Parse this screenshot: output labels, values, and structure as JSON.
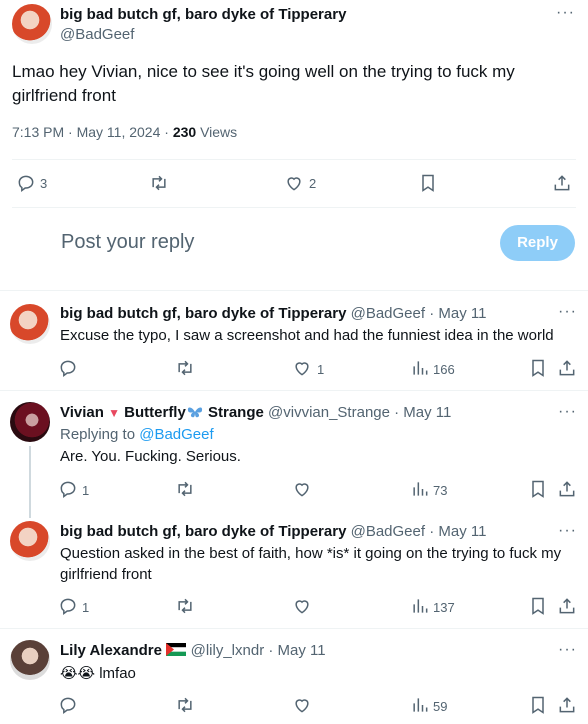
{
  "main": {
    "author_name": "big bad butch gf, baro dyke of Tipperary",
    "author_handle": "@BadGeef",
    "text": "Lmao hey Vivian, nice to see it's going well on the trying to fuck my girlfriend front",
    "timestamp": "7:13 PM · May 11, 2024 · ",
    "views_count": "230",
    "views_label": " Views",
    "reply_count": "3",
    "like_count": "2"
  },
  "composer": {
    "placeholder": "Post your reply",
    "button": "Reply"
  },
  "replies": [
    {
      "name": "big bad butch gf, baro dyke of Tipperary",
      "meta": " @BadGeef · May 11",
      "text": "Excuse the typo, I saw a screenshot and had the funniest idea in the world",
      "reply_count": "",
      "like_count": "1",
      "views": "166"
    },
    {
      "name_part1": "Vivian ",
      "name_part2": " Butterfly",
      "name_part3": " Strange",
      "meta": " @vivvian_Strange · May 11",
      "replying_prefix": "Replying to ",
      "replying_to": "@BadGeef",
      "text": "Are. You. Fucking. Serious.",
      "reply_count": "1",
      "like_count": "",
      "views": "73"
    },
    {
      "name": "big bad butch gf, baro dyke of Tipperary",
      "meta": " @BadGeef · May 11",
      "text": "Question asked in the best of faith, how *is* it going on the trying to fuck my girlfriend front",
      "reply_count": "1",
      "like_count": "",
      "views": "137"
    },
    {
      "name": "Lily Alexandre",
      "meta": " @lily_lxndr · May 11",
      "text": "😭😭 lmfao",
      "reply_count": "",
      "like_count": "",
      "views": "59"
    }
  ],
  "colors": {
    "accent": "#1d9bf0",
    "muted": "#536471",
    "text": "#0f1419",
    "reply_button": "#8ecdf8"
  },
  "icons": [
    "more-icon",
    "reply-icon",
    "retweet-icon",
    "like-icon",
    "bookmark-icon",
    "share-icon",
    "views-icon",
    "heart-emoji-icon",
    "butterfly-emoji-icon",
    "palestine-flag-icon"
  ]
}
